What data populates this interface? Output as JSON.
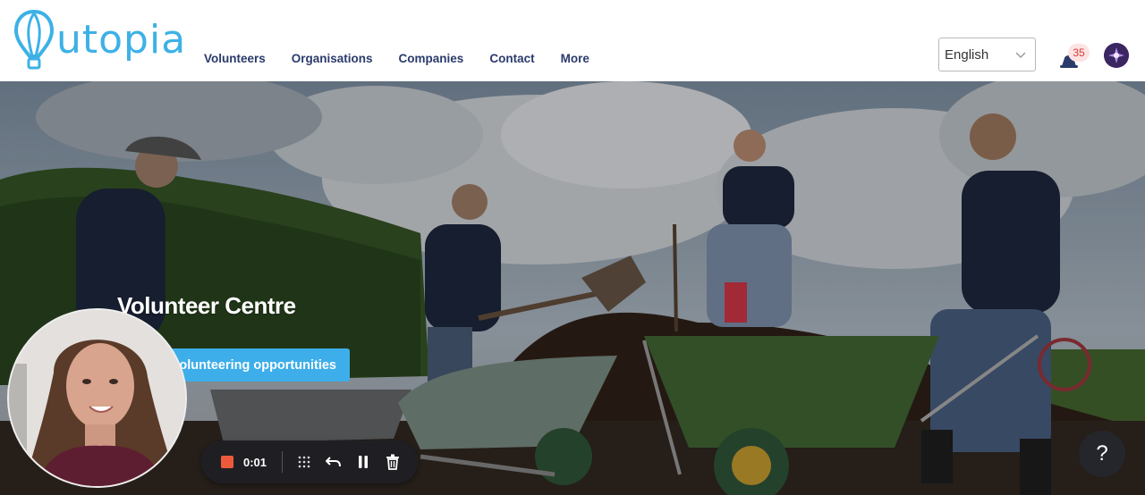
{
  "brand": {
    "logo_text": "utopia",
    "accent": "#3db1e6"
  },
  "nav": {
    "items": [
      {
        "label": "Volunteers"
      },
      {
        "label": "Organisations"
      },
      {
        "label": "Companies"
      },
      {
        "label": "Contact"
      },
      {
        "label": "More"
      }
    ]
  },
  "language": {
    "selected": "English",
    "icon": "chevron-down-icon"
  },
  "notifications": {
    "count": "35",
    "icon": "bell-icon"
  },
  "hero": {
    "title": "Volunteer Centre",
    "button_label": "olunteering opportunities",
    "button_color": "#3daee9"
  },
  "recorder": {
    "time": "0:01",
    "stop_color": "#ec5a3c"
  },
  "help": {
    "label": "?"
  }
}
